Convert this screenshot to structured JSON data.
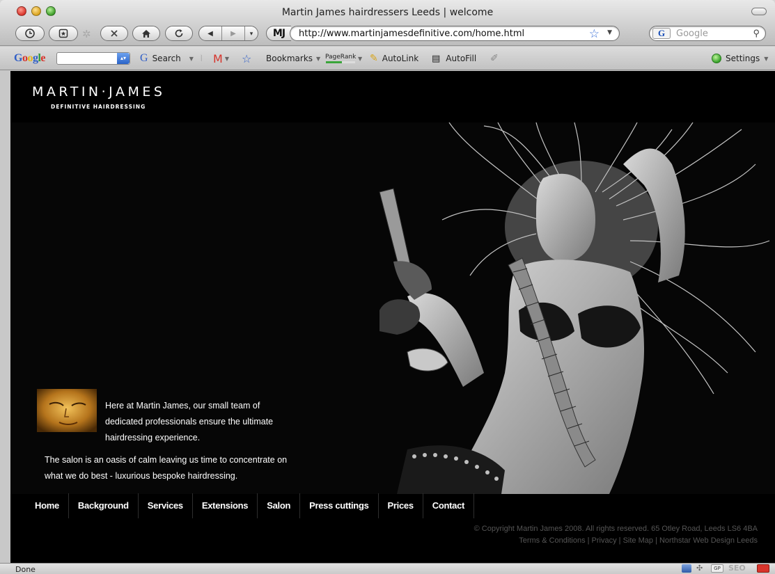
{
  "window": {
    "title": "Martin James hairdressers Leeds | welcome"
  },
  "navbar": {
    "site_icon_text": "MJ",
    "url": "http://www.martinjamesdefinitive.com/home.html",
    "search_placeholder": "Google",
    "search_engine_icon": "G"
  },
  "google_toolbar": {
    "logo": [
      "G",
      "o",
      "o",
      "g",
      "l",
      "e"
    ],
    "search_label": "Search",
    "bookmarks_label": "Bookmarks",
    "pagerank_label": "PageRank",
    "autolink_label": "AutoLink",
    "autofill_label": "AutoFill",
    "settings_label": "Settings"
  },
  "site": {
    "logo_main": "MARTIN·JAMES",
    "logo_sub": "DEFINITIVE HAIRDRESSING",
    "intro": "Here at Martin James, our small team of dedicated professionals ensure the ultimate hairdressing experience.",
    "body": "The salon is an oasis of calm leaving us time to concentrate on what we do best - luxurious bespoke hairdressing.",
    "nav": [
      "Home",
      "Background",
      "Services",
      "Extensions",
      "Salon",
      "Press cuttings",
      "Prices",
      "Contact"
    ],
    "copyright": "© Copyright Martin James 2008. All rights reserved. 65 Otley Road, Leeds LS6 4BA",
    "footer_links": "Terms & Conditions | Privacy | Site Map | Northstar Web Design Leeds"
  },
  "statusbar": {
    "status": "Done",
    "icons": [
      "network-icon",
      "puzzle-icon",
      "gp-icon",
      "seo-icon",
      "mail-icon"
    ]
  },
  "colors": {
    "page_bg": "#000000",
    "footer_text": "#555555",
    "link_star": "#3a6fd6"
  }
}
